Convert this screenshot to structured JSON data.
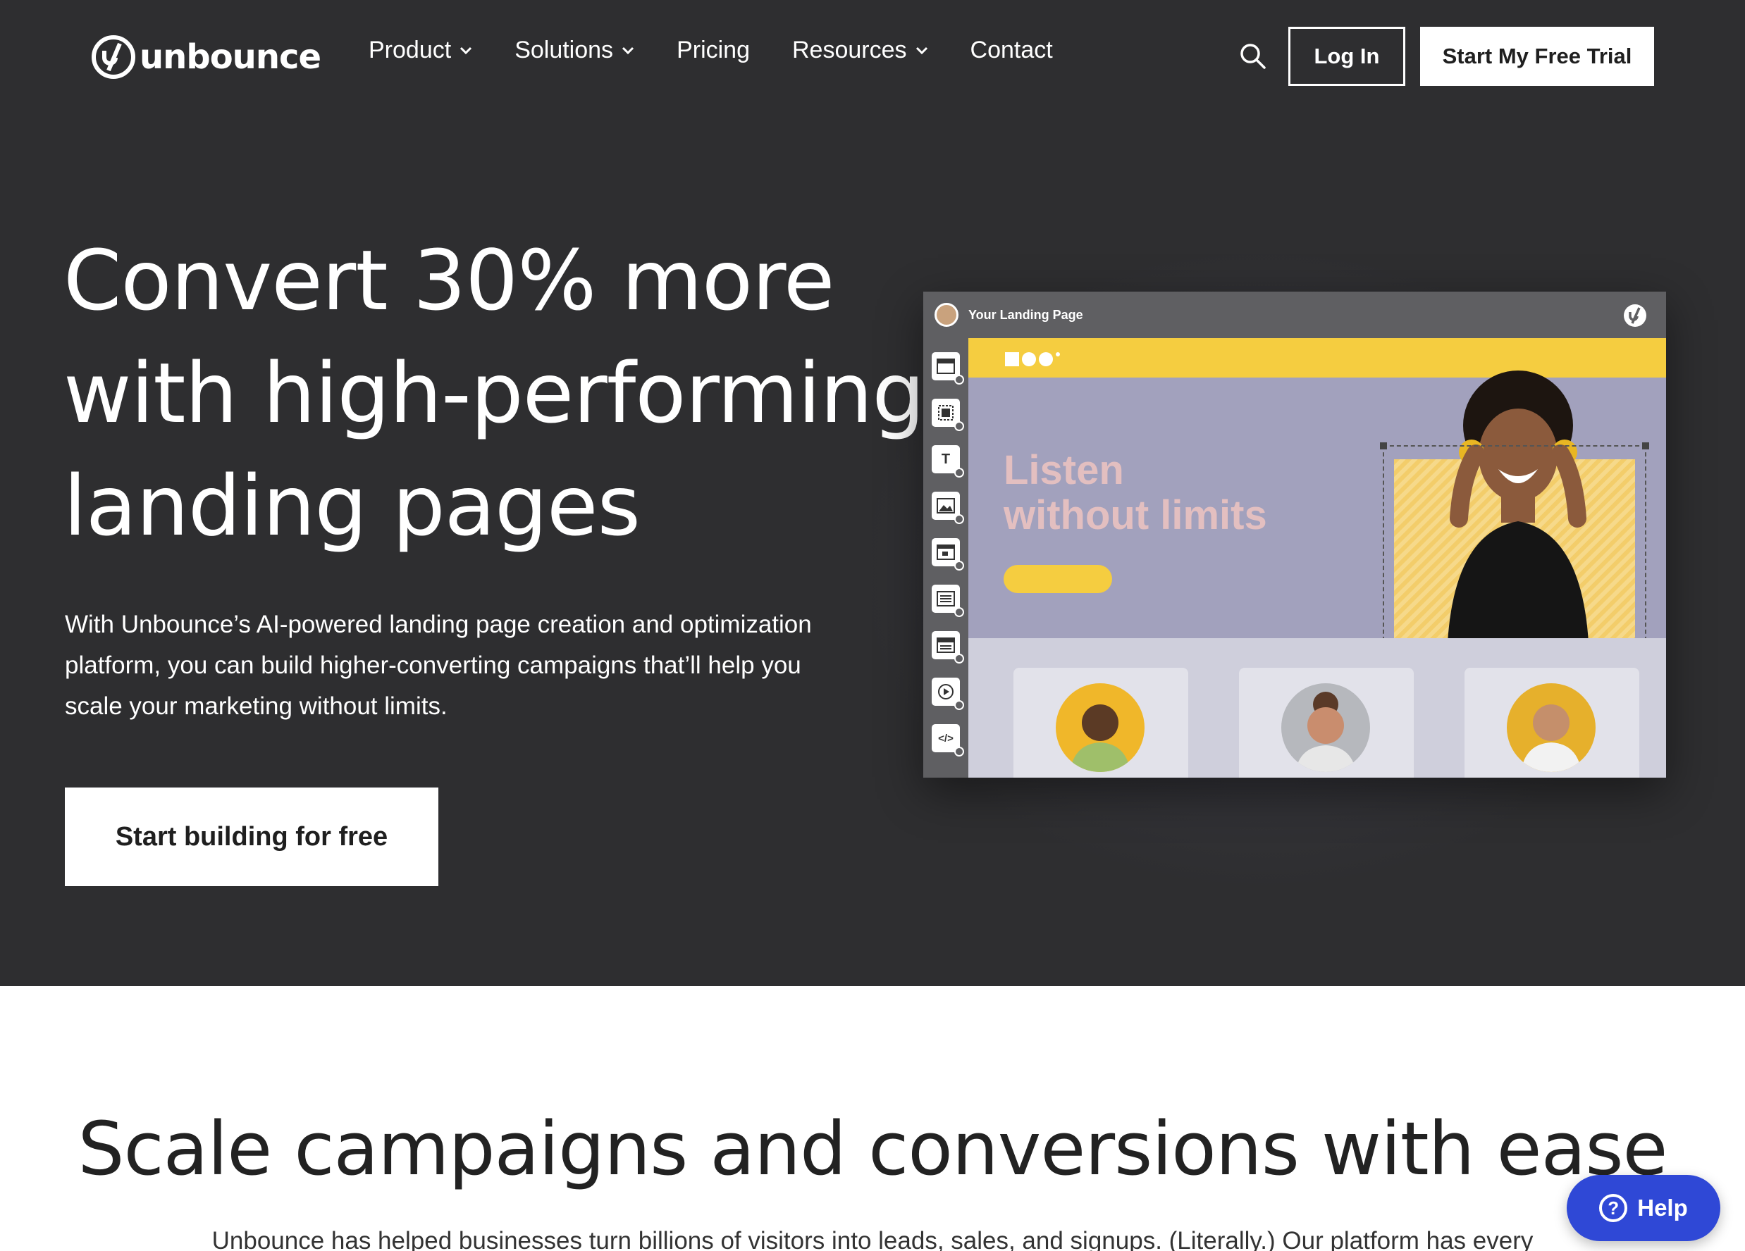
{
  "header": {
    "logo_text": "unbounce",
    "nav": [
      {
        "label": "Product",
        "has_dropdown": true
      },
      {
        "label": "Solutions",
        "has_dropdown": true
      },
      {
        "label": "Pricing",
        "has_dropdown": false
      },
      {
        "label": "Resources",
        "has_dropdown": true
      },
      {
        "label": "Contact",
        "has_dropdown": false
      }
    ],
    "search_icon": "search-icon",
    "login_label": "Log In",
    "trial_label": "Start My Free Trial"
  },
  "hero": {
    "title_lines": [
      "Convert 30% more",
      "with high-performing",
      "landing pages"
    ],
    "subtitle": "With Unbounce’s AI-powered landing page creation and optimization platform, you can build higher-converting campaigns that’ll help you scale your marketing without limits.",
    "cta_label": "Start building for free"
  },
  "mockup": {
    "title": "Your Landing Page",
    "headline_lines": [
      "Listen",
      "without limits"
    ],
    "tools": [
      "section",
      "box",
      "T",
      "image",
      "button",
      "form",
      "list",
      "video",
      "</>"
    ]
  },
  "section": {
    "title": "Scale campaigns and conversions with ease",
    "body": "Unbounce has helped businesses turn billions of visitors into leads, sales, and signups. (Literally.) Our platform has every"
  },
  "help": {
    "label": "Help"
  },
  "colors": {
    "hero_bg": "#2e2e30",
    "accent_yellow": "#f5cd40",
    "mock_purple": "#a2a1bd",
    "help_blue": "#2f48d6"
  }
}
